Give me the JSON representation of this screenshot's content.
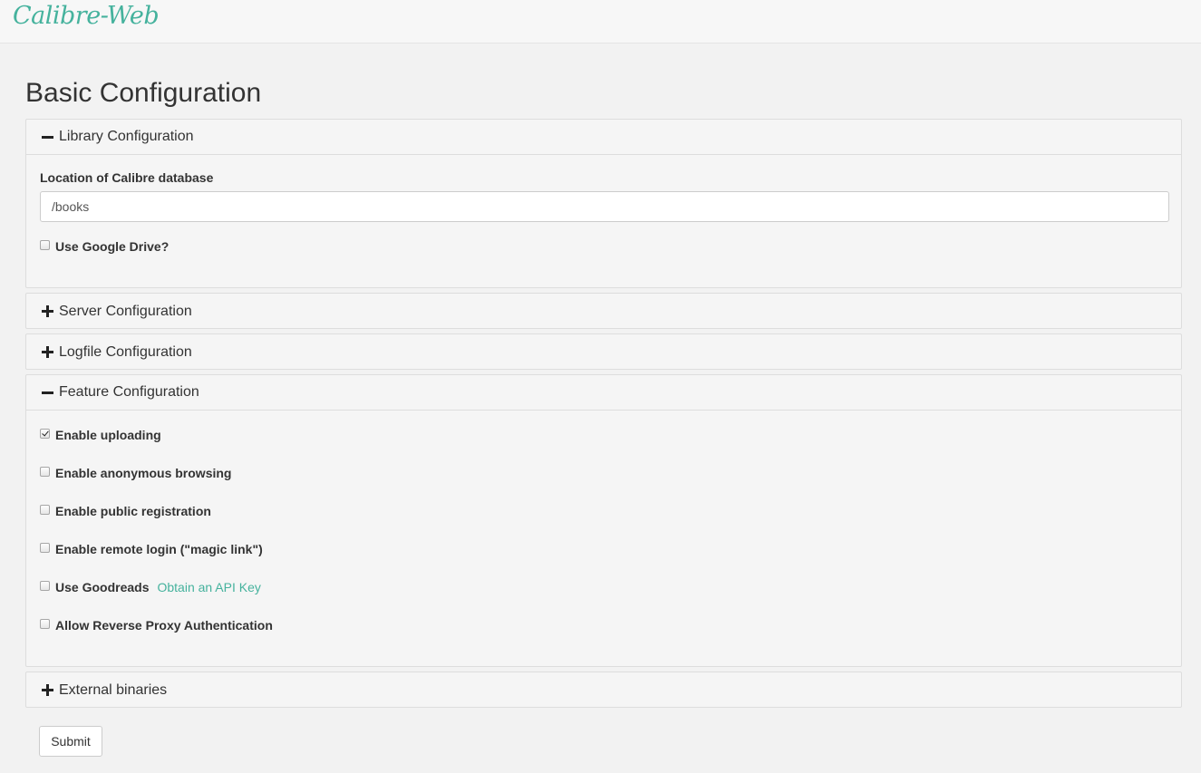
{
  "app": {
    "brand": "Calibre-Web"
  },
  "page": {
    "title": "Basic Configuration"
  },
  "colors": {
    "accent": "#45b29d",
    "background": "#f2f2f2",
    "panel": "#f5f5f5"
  },
  "sections": {
    "library": {
      "title": "Library Configuration",
      "expanded": true,
      "db_label": "Location of Calibre database",
      "db_value": "/books",
      "gdrive_label": "Use Google Drive?",
      "gdrive_checked": false
    },
    "server": {
      "title": "Server Configuration",
      "expanded": false
    },
    "logfile": {
      "title": "Logfile Configuration",
      "expanded": false
    },
    "feature": {
      "title": "Feature Configuration",
      "expanded": true,
      "options": [
        {
          "label": "Enable uploading",
          "checked": true
        },
        {
          "label": "Enable anonymous browsing",
          "checked": false
        },
        {
          "label": "Enable public registration",
          "checked": false
        },
        {
          "label": "Enable remote login (\"magic link\")",
          "checked": false
        },
        {
          "label": "Use Goodreads",
          "checked": false,
          "link": "Obtain an API Key"
        },
        {
          "label": "Allow Reverse Proxy Authentication",
          "checked": false
        }
      ]
    },
    "binaries": {
      "title": "External binaries",
      "expanded": false
    }
  },
  "icons": {
    "expanded": "minus-icon",
    "collapsed": "plus-icon"
  },
  "actions": {
    "submit_label": "Submit"
  }
}
